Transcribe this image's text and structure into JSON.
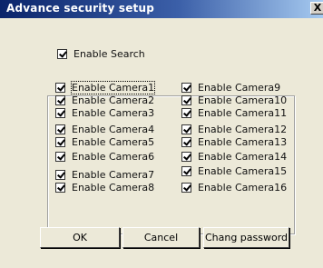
{
  "window": {
    "title": "Advance security setup",
    "close_label": "X"
  },
  "enable_search": {
    "label": "Enable Search",
    "checked": true
  },
  "cameras_left": [
    {
      "label": "Enable Camera1",
      "checked": true
    },
    {
      "label": "Enable Camera2",
      "checked": true
    },
    {
      "label": "Enable Camera3",
      "checked": true
    },
    {
      "label": "Enable Camera4",
      "checked": true
    },
    {
      "label": "Enable Camera5",
      "checked": true
    },
    {
      "label": "Enable Camera6",
      "checked": true
    },
    {
      "label": "Enable Camera7",
      "checked": true
    },
    {
      "label": "Enable Camera8",
      "checked": true
    }
  ],
  "cameras_right": [
    {
      "label": "Enable Camera9",
      "checked": true
    },
    {
      "label": "Enable Camera10",
      "checked": true
    },
    {
      "label": "Enable Camera11",
      "checked": true
    },
    {
      "label": "Enable Camera12",
      "checked": true
    },
    {
      "label": "Enable Camera13",
      "checked": true
    },
    {
      "label": "Enable Camera14",
      "checked": true
    },
    {
      "label": "Enable Camera15",
      "checked": true
    },
    {
      "label": "Enable Camera16",
      "checked": true
    }
  ],
  "buttons": {
    "ok": "OK",
    "cancel": "Cancel",
    "change_password": "Chang password"
  }
}
